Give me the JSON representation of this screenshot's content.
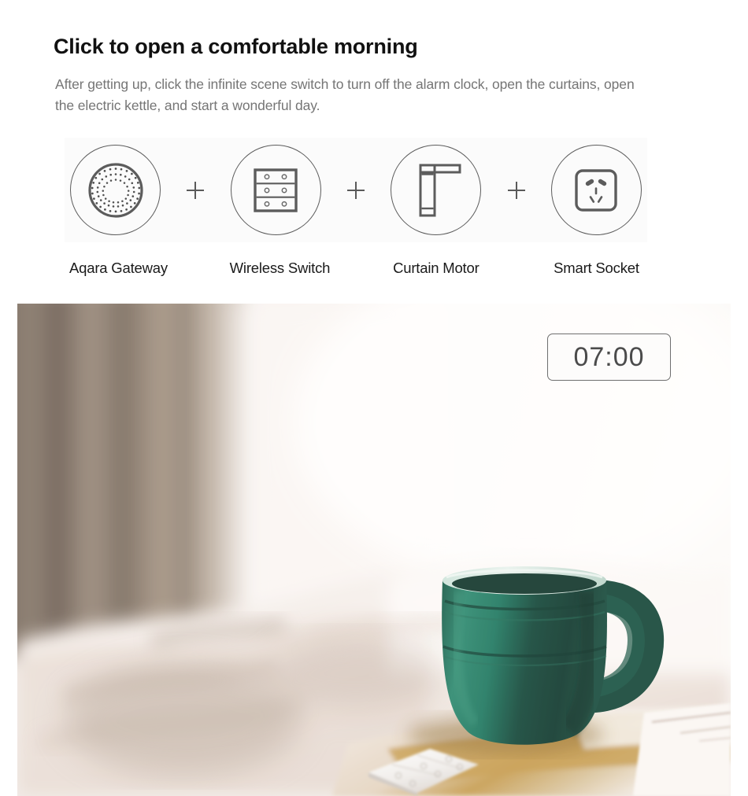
{
  "headline": "Click to open a comfortable morning",
  "subcopy": "After getting up, click the infinite scene switch to turn off the alarm clock, open the curtains, open the electric kettle, and start a wonderful day.",
  "devices": {
    "separator": "+",
    "items": [
      {
        "label": "Aqara Gateway",
        "icon": "gateway-icon"
      },
      {
        "label": "Wireless Switch",
        "icon": "wireless-switch-icon"
      },
      {
        "label": "Curtain Motor",
        "icon": "curtain-motor-icon"
      },
      {
        "label": "Smart Socket",
        "icon": "smart-socket-icon"
      }
    ]
  },
  "photo": {
    "alt": "bedroom-morning-scene",
    "clock_badge": {
      "time": "07:00"
    },
    "objects": [
      "curtain",
      "bed",
      "green-mug",
      "wooden-table",
      "wireless-switch-panel",
      "notebook"
    ]
  },
  "colors": {
    "heading": "#111111",
    "body_text": "#757575",
    "label_text": "#1a1a1a",
    "strip_background": "#fbfbfb",
    "icon_stroke": "#5c5c5c",
    "badge_border": "#6f6f6f",
    "badge_text": "#4b4b4b",
    "mug_green": "#1f6b55"
  }
}
